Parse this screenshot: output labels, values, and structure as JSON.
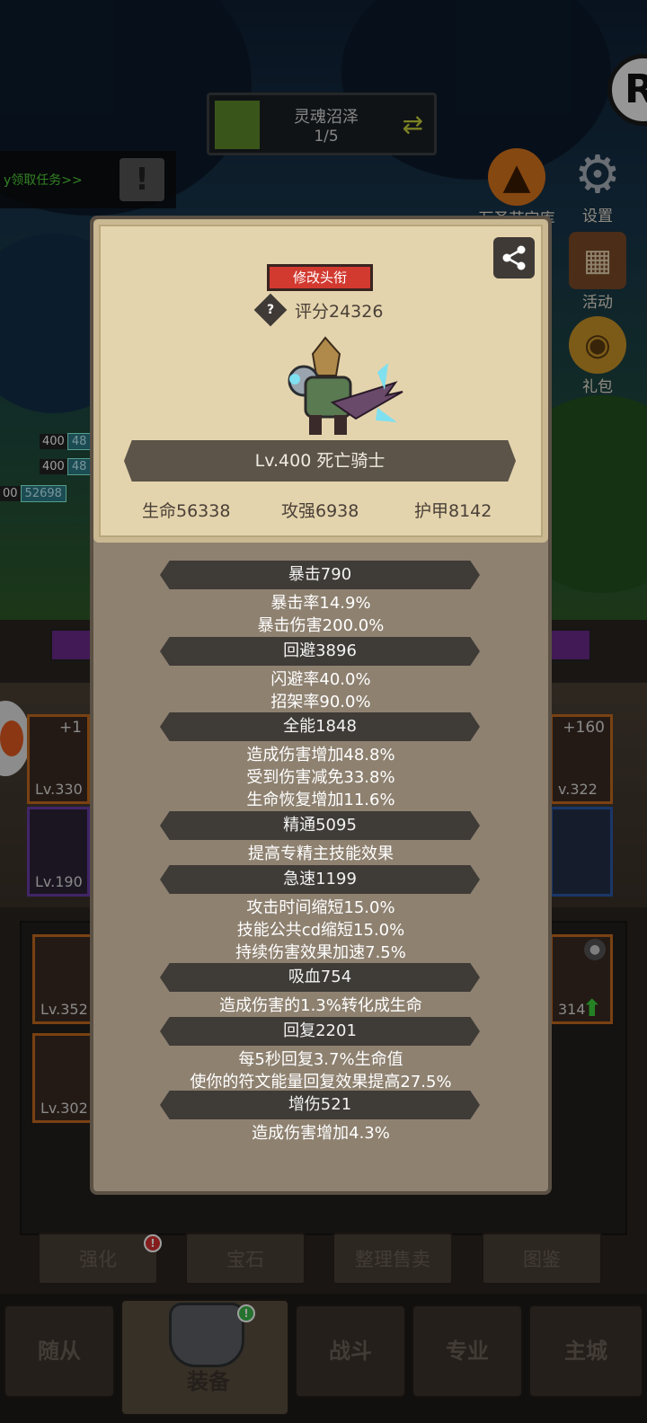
{
  "zone": {
    "name": "灵魂沼泽",
    "progress": "1/5"
  },
  "quest": {
    "text": "y领取任务>>"
  },
  "side_icons": {
    "halloween": "万圣节宝库",
    "settings": "设置",
    "events": "活动",
    "gift": "礼包"
  },
  "left_hp": [
    {
      "lv": "400",
      "val": "48"
    },
    {
      "lv": "400",
      "val": "48"
    },
    {
      "lv": "00",
      "val": "52698"
    }
  ],
  "slots": {
    "s1_plus": "+1",
    "s1_lv": "Lv.330",
    "s2_lv": "Lv.190",
    "s3_plus": "+160",
    "s3_lv": "v.322",
    "g1_lv": "Lv.352",
    "g2_lv": "Lv.302",
    "g3_lv": "314"
  },
  "actions": {
    "enhance": "强化",
    "gem": "宝石",
    "sort_sell": "整理售卖",
    "codex": "图鉴"
  },
  "nav": {
    "follower": "随从",
    "equipment": "装备",
    "battle": "战斗",
    "profession": "专业",
    "main_city": "主城"
  },
  "profile": {
    "edit_title": "修改头衔",
    "score": "评分24326",
    "name": "Lv.400 死亡骑士",
    "hp": "生命56338",
    "attack": "攻强6938",
    "armor": "护甲8142"
  },
  "stats": [
    {
      "head": "暴击790",
      "lines": [
        "暴击率14.9%",
        "暴击伤害200.0%"
      ]
    },
    {
      "head": "回避3896",
      "lines": [
        "闪避率40.0%",
        "招架率90.0%"
      ]
    },
    {
      "head": "全能1848",
      "lines": [
        "造成伤害增加48.8%",
        "受到伤害减免33.8%",
        "生命恢复增加11.6%"
      ]
    },
    {
      "head": "精通5095",
      "lines": [
        "提高专精主技能效果"
      ]
    },
    {
      "head": "急速1199",
      "lines": [
        "攻击时间缩短15.0%",
        "技能公共cd缩短15.0%",
        "持续伤害效果加速7.5%"
      ]
    },
    {
      "head": "吸血754",
      "lines": [
        "造成伤害的1.3%转化成生命"
      ]
    },
    {
      "head": "回复2201",
      "lines": [
        "每5秒回复3.7%生命值",
        "使你的符文能量回复效果提高27.5%"
      ]
    },
    {
      "head": "增伤521",
      "lines": [
        "造成伤害增加4.3%"
      ]
    }
  ]
}
